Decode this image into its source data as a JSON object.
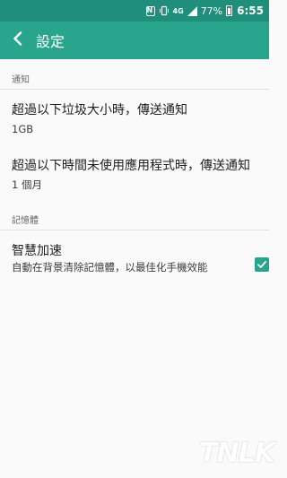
{
  "status_bar": {
    "icons": [
      "nfc-icon",
      "vibrate-icon",
      "4g-icon",
      "signal-icon",
      "battery-icon"
    ],
    "signal_label": "4G",
    "battery": "77%",
    "time": "6:55"
  },
  "app_bar": {
    "title": "設定",
    "back_icon": "chevron-left-icon",
    "color": "#2aa58d"
  },
  "sections": {
    "notify": {
      "header": "通知",
      "items": [
        {
          "title": "超過以下垃圾大小時，傳送通知",
          "value": "1GB"
        },
        {
          "title": "超過以下時間未使用應用程式時，傳送通知",
          "value": "1 個月"
        }
      ]
    },
    "memory": {
      "header": "記憶體",
      "items": [
        {
          "title": "智慧加速",
          "description": "自動在背景清除記憶體，以最佳化手機效能",
          "checked": true
        }
      ]
    }
  },
  "watermark": "TNLK"
}
